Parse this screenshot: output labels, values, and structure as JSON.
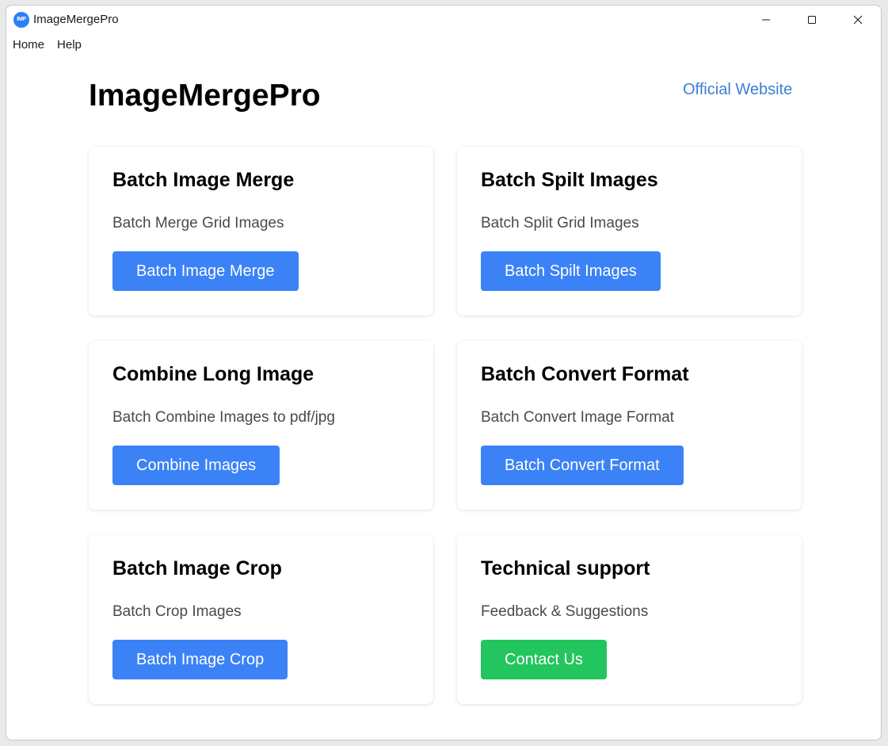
{
  "window": {
    "title": "ImageMergePro",
    "icon_text": "IMP"
  },
  "menu": {
    "items": [
      "Home",
      "Help"
    ]
  },
  "header": {
    "title": "ImageMergePro",
    "website_link": "Official Website"
  },
  "colors": {
    "primary_button": "#3b82f6",
    "success_button": "#22c55e",
    "link": "#3b7fd4"
  },
  "cards": [
    {
      "title": "Batch Image Merge",
      "description": "Batch Merge Grid Images",
      "button": "Batch Image Merge"
    },
    {
      "title": "Batch Spilt Images",
      "description": "Batch Split Grid Images",
      "button": "Batch Spilt Images"
    },
    {
      "title": "Combine Long Image",
      "description": "Batch Combine Images to pdf/jpg",
      "button": "Combine Images"
    },
    {
      "title": "Batch Convert Format",
      "description": "Batch Convert Image Format",
      "button": "Batch Convert Format"
    },
    {
      "title": "Batch Image Crop",
      "description": "Batch Crop Images",
      "button": "Batch Image Crop"
    },
    {
      "title": "Technical support",
      "description": "Feedback & Suggestions",
      "button": "Contact Us"
    }
  ]
}
